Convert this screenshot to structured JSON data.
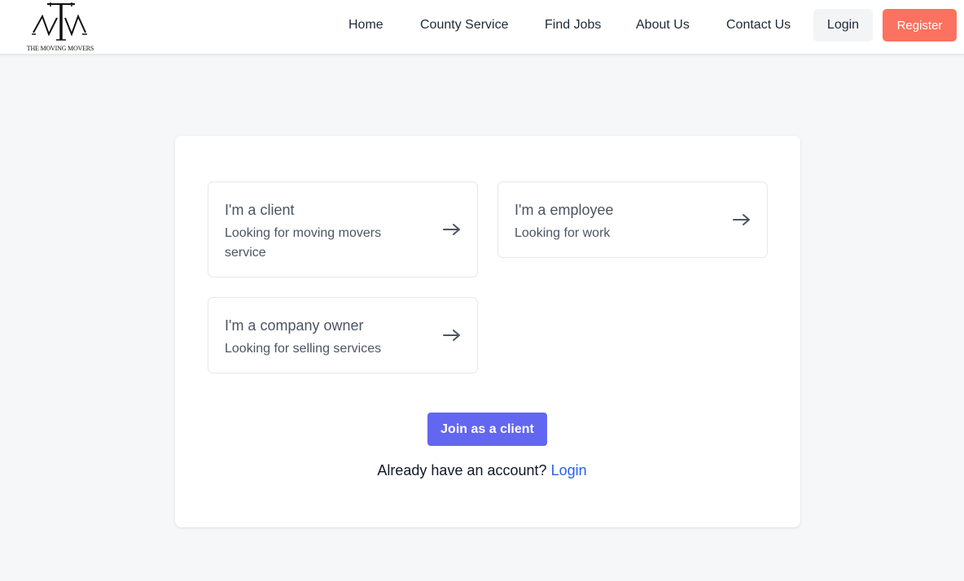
{
  "brand": {
    "logo_text": "THE MOVING MOVERS"
  },
  "nav": {
    "items": [
      {
        "label": "Home"
      },
      {
        "label": "County Service"
      },
      {
        "label": "Find Jobs"
      },
      {
        "label": "About Us"
      },
      {
        "label": "Contact Us"
      }
    ],
    "login_label": "Login",
    "register_label": "Register"
  },
  "options": [
    {
      "title": "I'm a client",
      "subtitle": "Looking for moving movers service",
      "icon": "arrow-right-icon"
    },
    {
      "title": "I'm a employee",
      "subtitle": "Looking for work",
      "icon": "arrow-right-icon"
    },
    {
      "title": "I'm a company owner",
      "subtitle": "Looking for selling services",
      "icon": "arrow-right-icon"
    }
  ],
  "join_button_label": "Join as a client",
  "account_prompt": "Already have an account?",
  "account_login_link": "Login",
  "colors": {
    "accent": "#6366f1",
    "register": "#fb7260",
    "link": "#2563eb",
    "background": "#f5f7f9"
  }
}
